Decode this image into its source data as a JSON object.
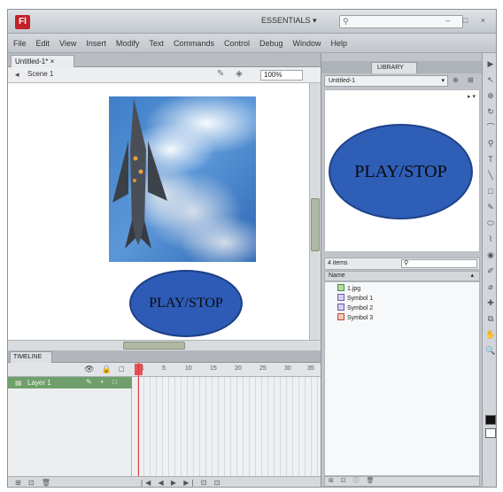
{
  "app": {
    "logo": "Fl",
    "workspace": "ESSENTIALS ▾",
    "window_controls": "– □ ×",
    "accent_color": "#c2202a"
  },
  "menu": [
    "File",
    "Edit",
    "View",
    "Insert",
    "Modify",
    "Text",
    "Commands",
    "Control",
    "Debug",
    "Window",
    "Help"
  ],
  "document": {
    "tab_label": "Untitled-1* ×",
    "scene_label": "Scene 1",
    "zoom": "100%"
  },
  "stage": {
    "button_label": "PLAY/STOP",
    "button_color": "#2d5bb5"
  },
  "timeline": {
    "tab_label": "TIMELINE",
    "layer_name": "Layer 1",
    "frame_numbers": [
      "1",
      "5",
      "10",
      "15",
      "20",
      "25",
      "30",
      "35"
    ],
    "header_icons": "👁 🔒 □",
    "footer_left": "⊞ ⊡ 🗑",
    "footer_right": "|◀ ◀ ▶ ▶| ⊡ ⊡"
  },
  "library": {
    "tab_label": "LIBRARY",
    "document_select": "Untitled-1",
    "preview_label": "PLAY/STOP",
    "items_count": "4 items",
    "search_placeholder": "",
    "column_name": "Name",
    "items": [
      {
        "label": "1.jpg",
        "type": "image"
      },
      {
        "label": "Symbol 1",
        "type": "symbol"
      },
      {
        "label": "Symbol 2",
        "type": "symbol"
      },
      {
        "label": "Symbol 3",
        "type": "symbol",
        "selected": true
      }
    ]
  },
  "tools": [
    "▶",
    "↖",
    "⊕",
    "↻",
    "⌒",
    "⚲",
    "T",
    "╲",
    "□",
    "✎",
    "⬭",
    "⌇",
    "◉",
    "✐",
    "⌀",
    "✚",
    "⧉",
    "✋",
    "🔍"
  ]
}
